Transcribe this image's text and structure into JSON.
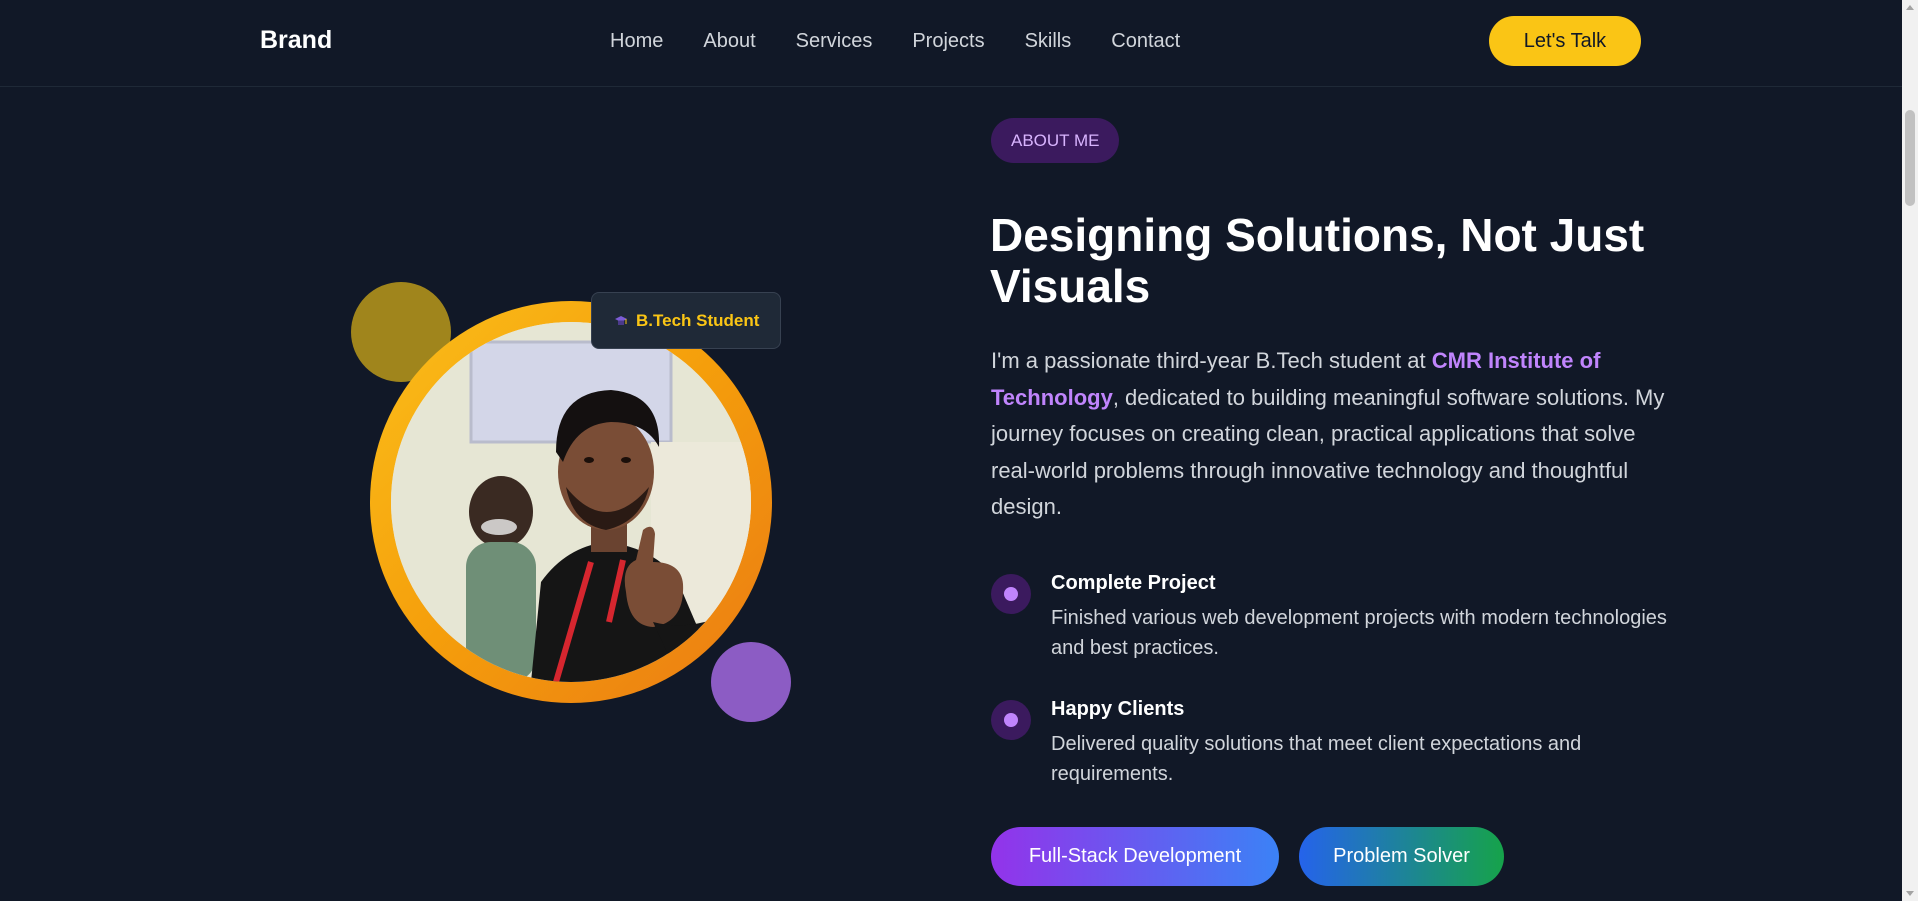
{
  "nav": {
    "brand": "Brand",
    "links": [
      "Home",
      "About",
      "Services",
      "Projects",
      "Skills",
      "Contact"
    ],
    "cta_label": "Let's Talk"
  },
  "about": {
    "pill": "ABOUT ME",
    "headline_line1": "Designing Solutions, Not Just",
    "headline_line2": "Visuals",
    "intro_prefix": "I'm a passionate third-year B.Tech student at ",
    "intro_highlight": "CMR Institute of Technology",
    "intro_suffix": ", dedicated to building meaningful software solutions. My journey focuses on creating clean, practical applications that solve real-world problems through innovative technology and thoughtful design.",
    "badge": {
      "icon": "graduation-cap-icon",
      "label": "B.Tech Student"
    },
    "features": [
      {
        "title": "Complete Project",
        "description": "Finished various web development projects with modern technologies and best practices."
      },
      {
        "title": "Happy Clients",
        "description": "Delivered quality solutions that meet client expectations and requirements."
      }
    ],
    "tags": [
      "Full-Stack Development",
      "Problem Solver"
    ]
  },
  "colors": {
    "background": "#111827",
    "accent_yellow": "#fac515",
    "accent_purple": "#c084fc"
  }
}
